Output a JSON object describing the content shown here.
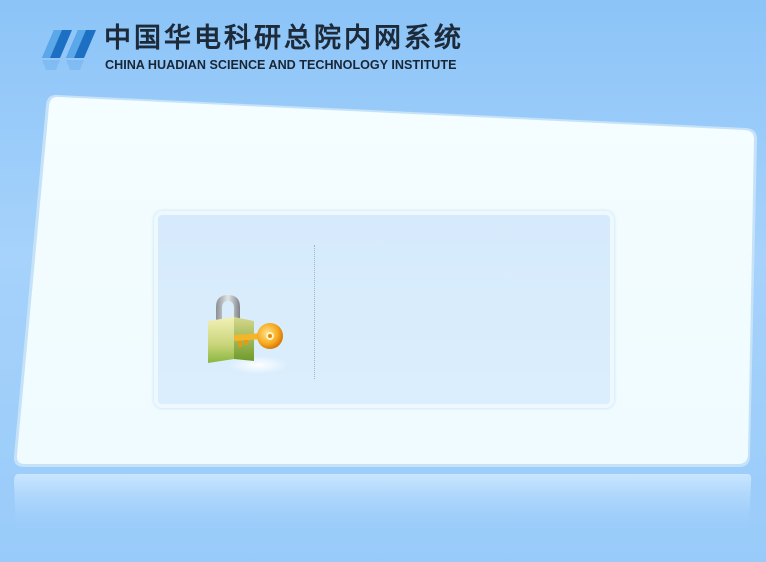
{
  "header": {
    "title": "中国华电科研总院内网系统",
    "subtitle": "CHINA HUADIAN SCIENCE AND TECHNOLOGY INSTITUTE",
    "logo_icon": "huadian-logo-icon"
  },
  "login": {
    "icon": "padlock-key-icon"
  },
  "colors": {
    "background": "#99cbfa",
    "panel": "#f2fcff",
    "login_box": "#d6ecfd",
    "logo_blue": "#1d6fc4",
    "logo_light": "#5aa8e8"
  }
}
